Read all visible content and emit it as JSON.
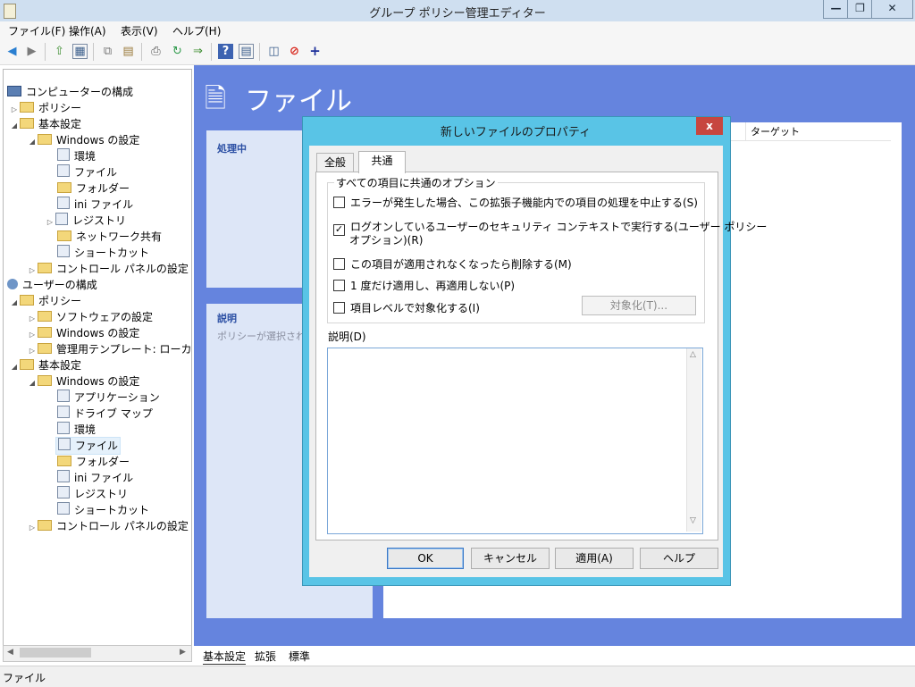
{
  "window": {
    "title": "グループ ポリシー管理エディター",
    "controls": {
      "minimize": "—",
      "restore": "❐",
      "close": "✕"
    }
  },
  "menu": [
    "ファイル(F)",
    "操作(A)",
    "表示(V)",
    "ヘルプ(H)"
  ],
  "tree": {
    "computer_config": "コンピューターの構成",
    "policy": "ポリシー",
    "basic_settings": "基本設定",
    "windows_settings": "Windows の設定",
    "environment": "環境",
    "files": "ファイル",
    "folders": "フォルダー",
    "ini_files": "ini ファイル",
    "registry": "レジストリ",
    "network_shares": "ネットワーク共有",
    "shortcuts": "ショートカット",
    "control_panel": "コントロール パネルの設定",
    "user_config": "ユーザーの構成",
    "software_settings": "ソフトウェアの設定",
    "admin_templates": "管理用テンプレート: ローカル コ",
    "applications": "アプリケーション",
    "drive_maps": "ドライブ マップ"
  },
  "content": {
    "title": "ファイル",
    "processing_label": "処理中",
    "description_label": "説明",
    "description_text": "ポリシーが選択されて",
    "target_column": "ターゲット"
  },
  "bottom_tabs": [
    "基本設定",
    "拡張",
    "標準"
  ],
  "status_text": "ファイル",
  "dialog": {
    "title": "新しいファイルのプロパティ",
    "close": "x",
    "tabs": {
      "general": "全般",
      "common": "共通"
    },
    "group_label": "すべての項目に共通のオプション",
    "options": {
      "stop_on_error": {
        "label": "エラーが発生した場合、この拡張子機能内での項目の処理を中止する(S)",
        "checked": false
      },
      "run_as_user_line1": {
        "label": "ログオンしているユーザーのセキュリティ コンテキストで実行する(ユーザー ポリシー",
        "checked": true
      },
      "run_as_user_line2": "オプション)(R)",
      "remove_when_not_applied": {
        "label": "この項目が適用されなくなったら削除する(M)",
        "checked": false
      },
      "apply_once": {
        "label": "1 度だけ適用し、再適用しない(P)",
        "checked": false
      },
      "item_level_targeting": {
        "label": "項目レベルで対象化する(I)",
        "checked": false
      }
    },
    "targeting_button": "対象化(T)...",
    "description_label": "説明(D)",
    "buttons": {
      "ok": "OK",
      "cancel": "キャンセル",
      "apply": "適用(A)",
      "help": "ヘルプ"
    }
  },
  "colors": {
    "content_bg": "#6584de",
    "dialog_frame": "#59c4e6",
    "dialog_close": "#c7463f"
  }
}
